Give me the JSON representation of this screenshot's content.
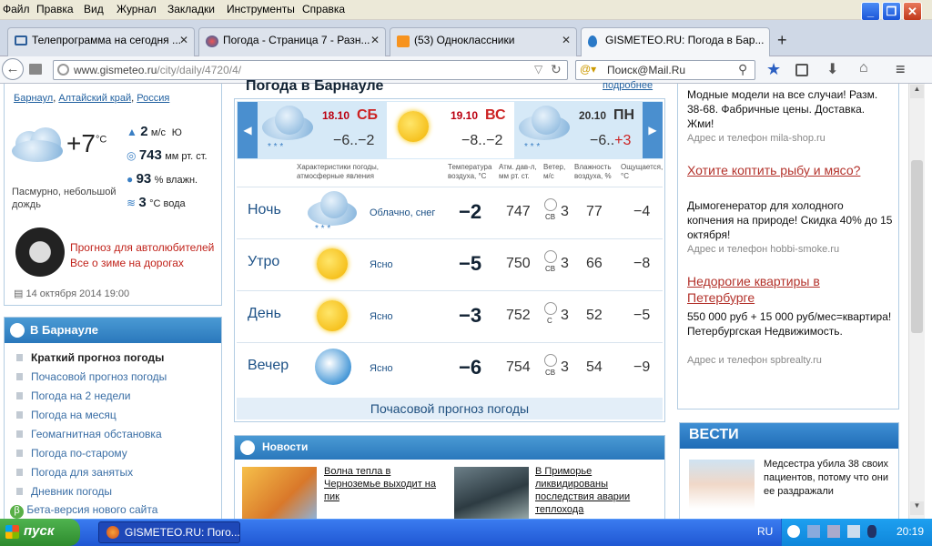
{
  "menu": [
    "Файл",
    "Правка",
    "Вид",
    "Журнал",
    "Закладки",
    "Инструменты",
    "Справка"
  ],
  "tabs": [
    {
      "title": "Телепрограмма на сегодня ...",
      "active": false
    },
    {
      "title": "Погода - Страница 7 - Разн...",
      "active": false
    },
    {
      "title": "(53) Одноклассники",
      "active": false
    },
    {
      "title": "GISMETEO.RU: Погода в Бар...",
      "active": true
    }
  ],
  "nav": {
    "url": "www.gismeteo.ru/city/daily/4720/4/",
    "url_prefix": "www.gismeteo.ru",
    "url_path": "/city/daily/4720/4/",
    "search_placeholder": "Поиск@Mail.Ru"
  },
  "current": {
    "breadcrumbs": [
      "Барнаул",
      "Алтайский край",
      "Россия"
    ],
    "temp": "+7",
    "temp_unit": "°C",
    "desc": "Пасмурно, небольшой дождь",
    "wind": "2",
    "wind_unit": "м/с",
    "wind_dir": "Ю",
    "pressure": "743",
    "pressure_unit": "мм рт. ст.",
    "humidity": "93",
    "humidity_unit": "% влажн.",
    "water": "3",
    "water_unit": "°С вода",
    "auto_line1": "Прогноз для автолюбителей",
    "auto_line2": "Все о зиме на дорогах",
    "timestamp": "14 октября 2014 19:00"
  },
  "sidebar": {
    "title": "В Барнауле",
    "items": [
      "Краткий прогноз погоды",
      "Почасовой прогноз погоды",
      "Погода на 2 недели",
      "Погода на месяц",
      "Геомагнитная обстановка",
      "Погода по-старому",
      "Погода для занятых",
      "Дневник погоды"
    ],
    "beta": "Бета-версия нового сайта"
  },
  "forecast": {
    "title": "Погода в Барнауле",
    "more": "подробнее",
    "days": [
      {
        "date": "18.10",
        "dow": "СБ",
        "temps": "−6..−2",
        "hi": ""
      },
      {
        "date": "19.10",
        "dow": "ВС",
        "temps": "−8..−2",
        "hi": ""
      },
      {
        "date": "20.10",
        "dow": "ПН",
        "temps": "−6..",
        "hi": "+3"
      }
    ],
    "headers": [
      "Характеристики погоды, атмосферные явления",
      "Температура воздуха, °С",
      "Атм. дав-л, мм рт. ст.",
      "Ветер, м/с",
      "Влажность воздуха, %",
      "Ощущается, °С"
    ],
    "rows": [
      {
        "period": "Ночь",
        "cond": "Облачно, снег",
        "temp": "−2",
        "pressure": "747",
        "wind_dir": "СВ",
        "wind": "3",
        "humidity": "77",
        "feels": "−4",
        "icon": "cloud-snow"
      },
      {
        "period": "Утро",
        "cond": "Ясно",
        "temp": "−5",
        "pressure": "750",
        "wind_dir": "СВ",
        "wind": "3",
        "humidity": "66",
        "feels": "−8",
        "icon": "sun"
      },
      {
        "period": "День",
        "cond": "Ясно",
        "temp": "−3",
        "pressure": "752",
        "wind_dir": "С",
        "wind": "3",
        "humidity": "52",
        "feels": "−5",
        "icon": "sun"
      },
      {
        "period": "Вечер",
        "cond": "Ясно",
        "temp": "−6",
        "pressure": "754",
        "wind_dir": "СВ",
        "wind": "3",
        "humidity": "54",
        "feels": "−9",
        "icon": "moon"
      }
    ],
    "hourly_link": "Почасовой прогноз погоды"
  },
  "news": {
    "title": "Новости",
    "items": [
      {
        "text": "Волна тепла в Черноземье выходит на пик"
      },
      {
        "text": "В Приморье ликвидированы последствия аварии теплохода"
      }
    ]
  },
  "ads": [
    {
      "title": "",
      "text": "Модные модели на все случаи! Разм. 38-68. Фабричные цены. Доставка. Жми!",
      "sub": "Адрес и телефон  mila-shop.ru"
    },
    {
      "title": "Хотите коптить рыбу и мясо?",
      "text": "Дымогенератор для холодного копчения на природе! Скидка 40% до 15 октября!",
      "sub": "Адрес и телефон  hobbi-smoke.ru"
    },
    {
      "title": "Недорогие квартиры в Петербурге",
      "text": "550 000 руб + 15 000 руб/мес=квартира! Петербургская Недвижимость.",
      "sub": "Адрес и телефон  spbrealty.ru"
    }
  ],
  "vesti": {
    "title": "ВЕСТИ",
    "text": "Медсестра убила 38 своих пациентов, потому что они ее раздражали"
  },
  "taskbar": {
    "start": "пуск",
    "window": "GISMETEO.RU: Пого...",
    "lang": "RU",
    "time": "20:19"
  }
}
